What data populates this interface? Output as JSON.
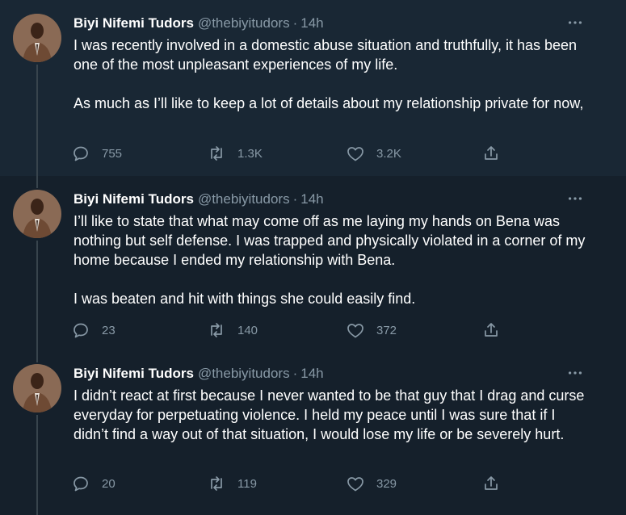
{
  "author": {
    "name": "Biyi Nifemi Tudors",
    "handle": "@thebiyitudors",
    "separator": "·"
  },
  "icons": {
    "more": "more-horizontal-icon",
    "reply": "reply-icon",
    "retweet": "retweet-icon",
    "like": "heart-icon",
    "share": "share-icon"
  },
  "colors": {
    "background": "#15202b",
    "highlight": "#192734",
    "secondary_text": "#8899a6",
    "thread_line": "#38444d"
  },
  "tweets": [
    {
      "time": "14h",
      "text": "I was recently involved in a domestic abuse situation and truthfully, it has been one of the most unpleasant experiences of my life.\n\nAs much as I’ll like to keep a lot of details about my relationship private for now,",
      "replies": "755",
      "retweets": "1.3K",
      "likes": "3.2K"
    },
    {
      "time": "14h",
      "text": "I’ll like to state that what may come off as me laying my hands on Bena was nothing but self defense. I was trapped and physically violated in a corner of my home because I ended my relationship with Bena.\n\nI was beaten and hit with things she could easily find.",
      "replies": "23",
      "retweets": "140",
      "likes": "372"
    },
    {
      "time": "14h",
      "text": "I didn’t react at first because I never wanted to be that guy that I drag and curse everyday for perpetuating violence. I held my peace until I was sure that if I didn’t find a way out of that situation, I would lose my life or be severely hurt.",
      "replies": "20",
      "retweets": "119",
      "likes": "329"
    }
  ]
}
